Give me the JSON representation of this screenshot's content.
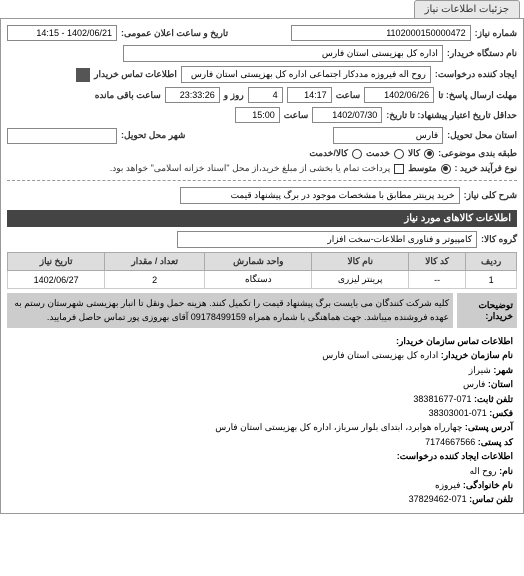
{
  "tab_label": "جزئیات اطلاعات نیاز",
  "fields": {
    "req_no_label": "شماره نیاز:",
    "req_no": "1102000150000472",
    "ann_date_label": "تاریخ و ساعت اعلان عمومی:",
    "ann_date": "1402/06/21 - 14:15",
    "buyer_label": "نام دستگاه خریدار:",
    "buyer": "اداره کل بهزیستی استان فارس",
    "requester_label": "ایجاد کننده درخواست:",
    "requester": "روح اله فیروزه مددکار اجتماعی اداره کل بهزیستی استان فارس",
    "contact_buyer_label": "اطلاعات تماس خریدار",
    "resp_deadline_label": "مهلت ارسال پاسخ: تا",
    "resp_date": "1402/06/26",
    "saat_label": "ساعت",
    "resp_time": "14:17",
    "remain_days": "4",
    "roz_va_label": "روز و",
    "remain_time": "23:33:26",
    "remain_suffix": "ساعت باقی مانده",
    "valid_label": "حداقل تاریخ اعتبار پیشنهاد: تا تاریخ:",
    "valid_date": "1402/07/30",
    "valid_time": "15:00",
    "prov_label": "استان محل تحویل:",
    "prov": "فارس",
    "city_label": "شهر محل تحویل:",
    "class_label": "طبقه بندی موضوعی:",
    "opt_kala": "کالا",
    "opt_khadamat": "خدمت",
    "opt_both": "کالا/خدمت",
    "purchase_note_label": "نوع فرآیند خرید :",
    "opt_mid": "متوسط",
    "purchase_note": "پرداخت تمام یا بخشی از مبلغ خرید،از محل \"اسناد خزانه اسلامی\" خواهد بود.",
    "general_desc_label": "شرح کلی نیاز:",
    "general_desc": "خرید پرینتر مطابق با مشخصات موجود در برگ پیشنهاد قیمت"
  },
  "section_items": "اطلاعات کالاهای مورد نیاز",
  "group_label": "گروه کالا:",
  "group_value": "کامپیوتر و فناوری اطلاعات-سخت افزار",
  "table": {
    "headers": [
      "ردیف",
      "کد کالا",
      "نام کالا",
      "واحد شمارش",
      "تعداد / مقدار",
      "تاریخ نیاز"
    ],
    "row": [
      "1",
      "--",
      "پرینتر لیزری",
      "دستگاه",
      "2",
      "1402/06/27"
    ]
  },
  "description": {
    "label": "توضیحات خریدار:",
    "text": "کلیه شرکت کنندگان می بایست برگ پیشنهاد قیمت را تکمیل کنند. هزینه حمل ونقل تا انبار بهزیستی شهرستان رستم به عهده فروشنده میباشد. جهت هماهنگی با شماره همراه 09178499159 آقای بهروزی پور تماس حاصل فرمایید."
  },
  "contact": {
    "title": "اطلاعات تماس سازمان خریدار:",
    "org_label": "نام سازمان خریدار:",
    "org": "اداره کل بهزیستی استان فارس",
    "city_label": "شهر:",
    "city": "شیراز",
    "prov_label": "استان:",
    "prov": "فارس",
    "tel_label": "تلفن ثابت:",
    "tel": "071-38381677",
    "fax_label": "فکس:",
    "fax": "071-38303001",
    "addr_label": "آدرس پستی:",
    "addr": "چهارراه هوابرد، ابتدای بلوار سرباز، اداره کل بهزیستی استان فارس",
    "zip_label": "کد پستی:",
    "zip": "7174667566",
    "req_creator_title": "اطلاعات ایجاد کننده درخواست:",
    "name_label": "نام:",
    "name": "روح اله",
    "lname_label": "نام خانوادگی:",
    "lname": "فیروزه",
    "ctel_label": "تلفن تماس:",
    "ctel": "071-37829462"
  }
}
